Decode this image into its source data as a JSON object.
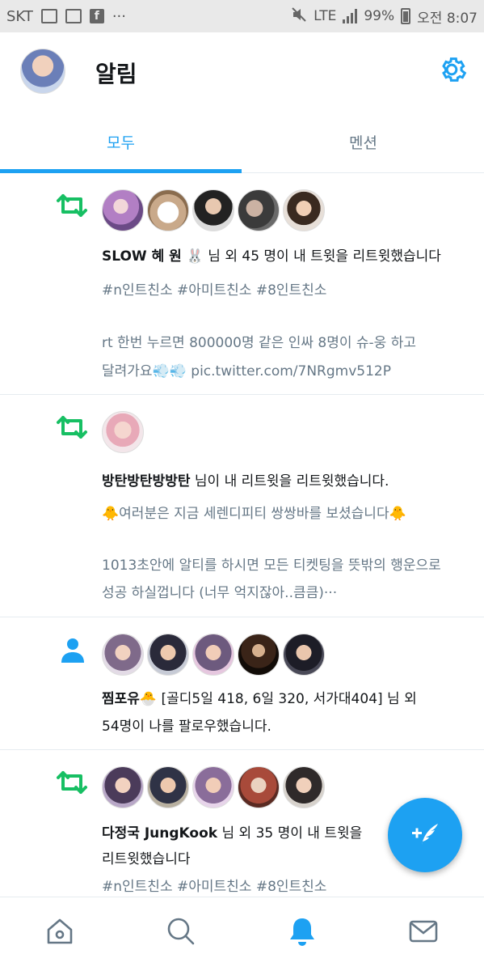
{
  "status_bar": {
    "carrier": "SKT",
    "more": "···",
    "network": "LTE",
    "battery": "99%",
    "time": "오전 8:07"
  },
  "header": {
    "title": "알림"
  },
  "tabs": [
    {
      "label": "모두",
      "selected": true
    },
    {
      "label": "멘션",
      "selected": false
    }
  ],
  "notifications": [
    {
      "kind": "retweet-icon",
      "lines": [
        {
          "bold": "SLOW 혜 원 🐰",
          "text": " 님 외 45 명이 내 트윗을 리트윗했습니다"
        },
        {
          "text": "#n인트친소 #아미트친소 #8인트친소"
        },
        {
          "text": "rt 한번 누르면 800000명 같은 인싸 8명이 슈-웅 하고"
        },
        {
          "text": "달려가요💨💨 pic.twitter.com/7NRgmv512P"
        }
      ]
    },
    {
      "kind": "retweet-icon",
      "lines": [
        {
          "bold": "방탄방탄방방탄",
          "text": " 님이 내 리트윗을 리트윗했습니다."
        },
        {
          "text": "🐥여러분은 지금 세렌디피티 쌍쌍바를 보셨습니다🐥"
        },
        {
          "text": "1013초안에 알티를 하시면 모든 티켓팅을 뜻밖의 행운으로"
        },
        {
          "text": "성공 하실껍니다 (너무 억지잖아..큼큼)···"
        }
      ]
    },
    {
      "kind": "follow-icon",
      "lines": [
        {
          "bold": "찜포유🐣",
          "text": " [골디5일 418, 6일 320, 서가대404] 님 외"
        },
        {
          "text": "54명이 나를 팔로우했습니다."
        }
      ]
    },
    {
      "kind": "retweet-icon",
      "lines": [
        {
          "bold": "다정국 JungKook",
          "text": "  님 외 35 명이 내 트윗을"
        },
        {
          "text": "리트윗했습니다"
        },
        {
          "text": "#n인트친소 #아미트친소 #8인트친소"
        }
      ]
    }
  ],
  "colors": {
    "accent": "#1da1f2",
    "retweet": "#17bf63",
    "secondary_text": "#657786"
  },
  "bottom_nav": [
    {
      "icon": "home-icon"
    },
    {
      "icon": "search-icon"
    },
    {
      "icon": "notifications-bell-icon",
      "selected": true
    },
    {
      "icon": "messages-icon"
    }
  ],
  "fab": {
    "icon": "compose-tweet-icon"
  }
}
